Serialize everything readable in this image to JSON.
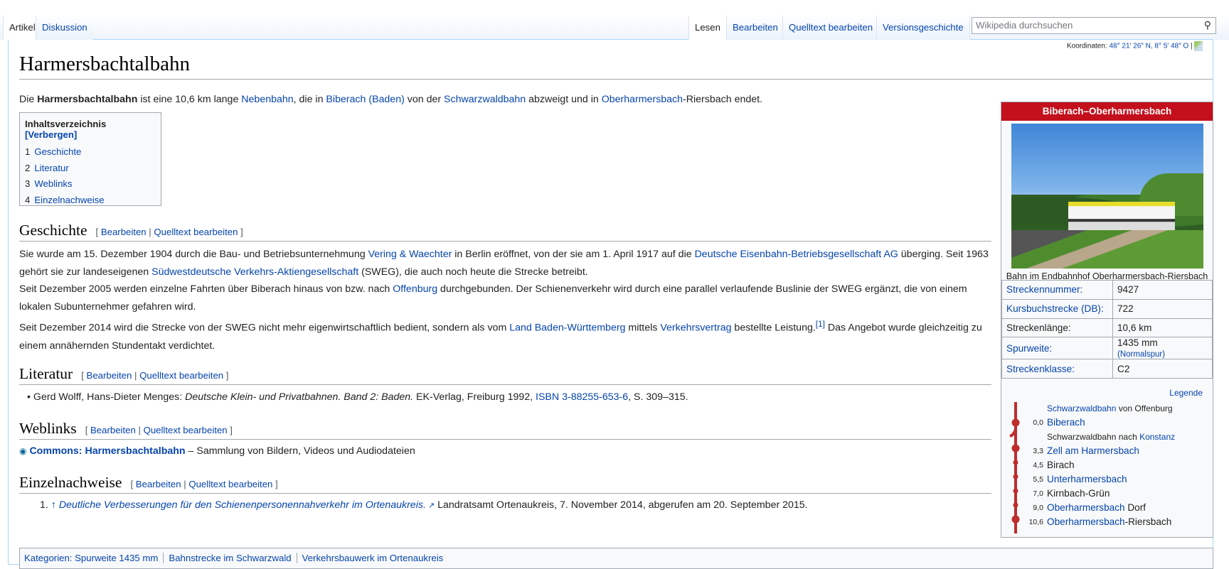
{
  "tabs": {
    "left": [
      "Artikel",
      "Diskussion"
    ],
    "right": [
      "Lesen",
      "Bearbeiten",
      "Quelltext bearbeiten",
      "Versionsgeschichte"
    ]
  },
  "search": {
    "placeholder": "Wikipedia durchsuchen"
  },
  "coords": {
    "label": "Koordinaten:",
    "value": "48° 21′ 26″ N, 8° 5′ 48″ O",
    "sep": "|"
  },
  "title": "Harmersbachtalbahn",
  "intro": {
    "a": "Die ",
    "bold": "Harmersbachtalbahn",
    "b": " ist eine 10,6 km lange ",
    "l1": "Nebenbahn",
    "c": ", die in ",
    "l2": "Biberach (Baden)",
    "d": " von der ",
    "l3": "Schwarzwaldbahn",
    "e": " abzweigt und in ",
    "l4": "Oberharmersbach",
    "f": "-Riersbach endet."
  },
  "toc": {
    "title": "Inhaltsverzeichnis",
    "toggle": "[Verbergen]",
    "items": [
      {
        "n": "1",
        "t": "Geschichte"
      },
      {
        "n": "2",
        "t": "Literatur"
      },
      {
        "n": "3",
        "t": "Weblinks"
      },
      {
        "n": "4",
        "t": "Einzelnachweise"
      }
    ]
  },
  "edit": {
    "open": "[ ",
    "edit": "Bearbeiten",
    "pipe": " | ",
    "source": "Quelltext bearbeiten",
    "close": " ]"
  },
  "headings": {
    "geschichte": "Geschichte",
    "literatur": "Literatur",
    "weblinks": "Weblinks",
    "einzel": "Einzelnachweise"
  },
  "p1": {
    "a": "Sie wurde am 15. Dezember 1904 durch die Bau- und Betriebsunternehmung ",
    "l1": "Vering & Waechter",
    "b": " in Berlin eröffnet, von der sie am 1. April 1917 auf die ",
    "l2": "Deutsche Eisenbahn-Betriebsgesellschaft AG",
    "c": " überging. Seit 1963 gehört sie zur landeseigenen ",
    "l3": "Südwestdeutsche Verkehrs-Aktiengesellschaft",
    "d": " (SWEG), die auch noch heute die Strecke betreibt."
  },
  "p2": {
    "a": "Seit Dezember 2005 werden einzelne Fahrten über Biberach hinaus von bzw. nach ",
    "l1": "Offenburg",
    "b": " durchgebunden. Der Schienenverkehr wird durch eine parallel verlaufende Buslinie der SWEG ergänzt, die von einem lokalen Subunternehmer gefahren wird."
  },
  "p3": {
    "a": "Seit Dezember 2014 wird die Strecke von der SWEG nicht mehr eigenwirtschaftlich bedient, sondern als vom ",
    "l1": "Land Baden-Württemberg",
    "b": " mittels ",
    "l2": "Verkehrsvertrag",
    "c": " bestellte Leistung.",
    "ref": "[1]",
    "d": " Das Angebot wurde gleichzeitig zu einem annähernden Stundentakt verdichtet."
  },
  "lit": {
    "a": "Gerd Wolff, Hans-Dieter Menges: ",
    "i": "Deutsche Klein- und Privatbahnen. Band 2: Baden.",
    "b": " EK-Verlag, Freiburg 1992, ",
    "l1": "ISBN 3-88255-653-6",
    "c": ", S. 309–315."
  },
  "web": {
    "l1": "Commons: Harmersbachtalbahn",
    "a": " – Sammlung von Bildern, Videos und Audiodateien"
  },
  "refs": {
    "n": "1.",
    "arrow": "↑",
    "l1": "Deutliche Verbesserungen für den Schienenpersonennahverkehr im Ortenaukreis.",
    "a": " Landratsamt Ortenaukreis, 7. November 2014, abgerufen am 20. September 2015."
  },
  "categories": {
    "label": "Kategorien:",
    "items": [
      "Spurweite 1435 mm",
      "Bahnstrecke im Schwarzwald",
      "Verkehrsbauwerk im Ortenaukreis"
    ]
  },
  "infobox": {
    "title": "Biberach–Oberharmersbach",
    "caption": "Bahn im Endbahnhof Oberharmersbach-Riersbach",
    "rows": [
      {
        "k": "Streckennummer:",
        "v": "9427",
        "link": true
      },
      {
        "k": "Kursbuchstrecke (DB):",
        "v": "722",
        "link": true
      },
      {
        "k": "Streckenlänge:",
        "v": "10,6 km",
        "link": false
      },
      {
        "k": "Spurweite:",
        "v": "1435 mm",
        "extra": "(Normalspur)",
        "link": true
      },
      {
        "k": "Streckenklasse:",
        "v": "C2",
        "link": true
      }
    ],
    "legend": "Legende",
    "route": [
      {
        "km": "",
        "l": "Schwarzwaldbahn",
        "t": " von Offenburg"
      },
      {
        "km": "0,0",
        "l": "Biberach",
        "t": ""
      },
      {
        "km": "",
        "t": "Schwarzwaldbahn nach ",
        "l": "Konstanz"
      },
      {
        "km": "3,3",
        "l": "Zell am Harmersbach",
        "t": ""
      },
      {
        "km": "4,5",
        "l": "",
        "t": "Birach"
      },
      {
        "km": "5,5",
        "l": "Unterharmersbach",
        "t": ""
      },
      {
        "km": "7,0",
        "l": "",
        "t": "Kirnbach-Grün"
      },
      {
        "km": "9,0",
        "l": "Oberharmersbach",
        "t": " Dorf"
      },
      {
        "km": "10,6",
        "l": "Oberharmersbach",
        "t": "-Riersbach"
      }
    ]
  }
}
